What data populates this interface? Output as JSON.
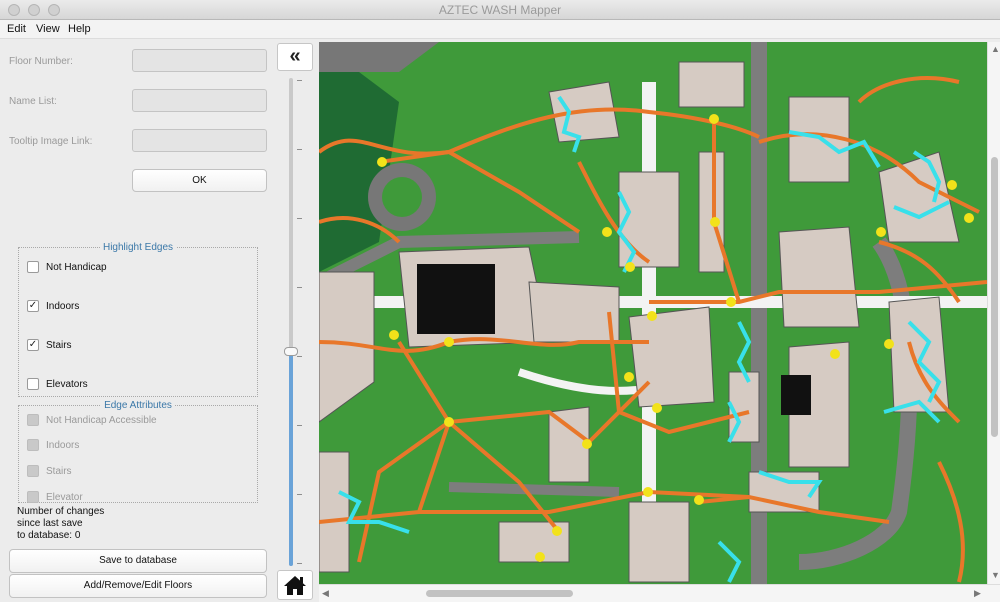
{
  "window": {
    "title": "AZTEC WASH Mapper"
  },
  "menu": [
    "Edit",
    "View",
    "Help"
  ],
  "fields": {
    "floor_number_label": "Floor Number:",
    "name_list_label": "Name List:",
    "tooltip_label": "Tooltip Image Link:",
    "ok_label": "OK"
  },
  "highlight": {
    "title": "Highlight Edges",
    "items": [
      {
        "label": "Not Handicap",
        "checked": false
      },
      {
        "label": "Indoors",
        "checked": true
      },
      {
        "label": "Stairs",
        "checked": true
      },
      {
        "label": "Elevators",
        "checked": false
      }
    ]
  },
  "attributes": {
    "title": "Edge Attributes",
    "items": [
      "Not Handicap Accessible",
      "Indoors",
      "Stairs",
      "Elevator"
    ]
  },
  "changes": {
    "line1": "Number of changes",
    "line2": "since last save",
    "line3": "to database: 0"
  },
  "buttons": {
    "save": "Save to database",
    "floors": "Add/Remove/Edit Floors",
    "collapse": "«"
  },
  "icons": {
    "collapse": "double-chevron-left-icon",
    "home": "home-icon"
  },
  "colors": {
    "grass": "#3f9a3a",
    "path": "#e8772a",
    "node": "#f2e21a",
    "building": "#d6cbc3",
    "highlight": "#38e0ea"
  },
  "floor_slider": {
    "value_fraction": 0.44
  }
}
